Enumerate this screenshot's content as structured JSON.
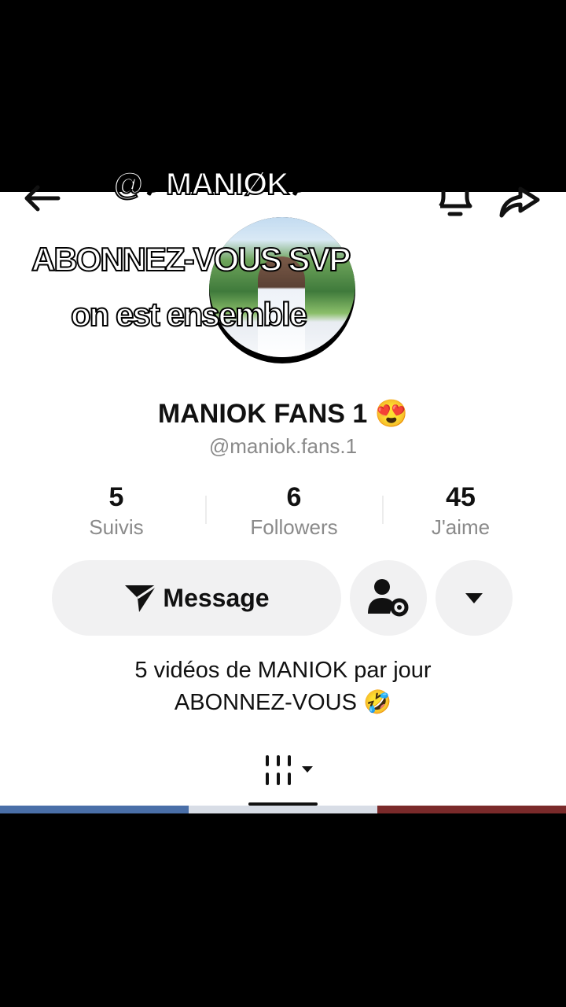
{
  "overlay": {
    "title": "@⸙MANIØK⸙",
    "sticker_line1": "ABONNEZ-VOUS SVP",
    "sticker_line2": "on est ensemble"
  },
  "header": {
    "back_icon": "arrow-left-icon",
    "bell_icon": "bell-icon",
    "share_icon": "share-arrow-icon"
  },
  "profile": {
    "name": "MANIOK FANS 1 😍",
    "handle": "@maniok.fans.1"
  },
  "stats": [
    {
      "value": "5",
      "label": "Suivis"
    },
    {
      "value": "6",
      "label": "Followers"
    },
    {
      "value": "45",
      "label": "J'aime"
    }
  ],
  "actions": {
    "message_label": "Message",
    "message_icon": "send-icon",
    "friends_icon": "person-gear-icon",
    "dropdown_icon": "caret-down-icon"
  },
  "bio": {
    "line1": "5 vidéos de MANIOK par jour",
    "line2": "ABONNEZ-VOUS 🤣"
  },
  "tabs": {
    "videos_icon": "grid-icon"
  },
  "colors": {
    "button_bg": "#f1f1f2",
    "muted_text": "#8a8a8a",
    "text": "#111111"
  }
}
